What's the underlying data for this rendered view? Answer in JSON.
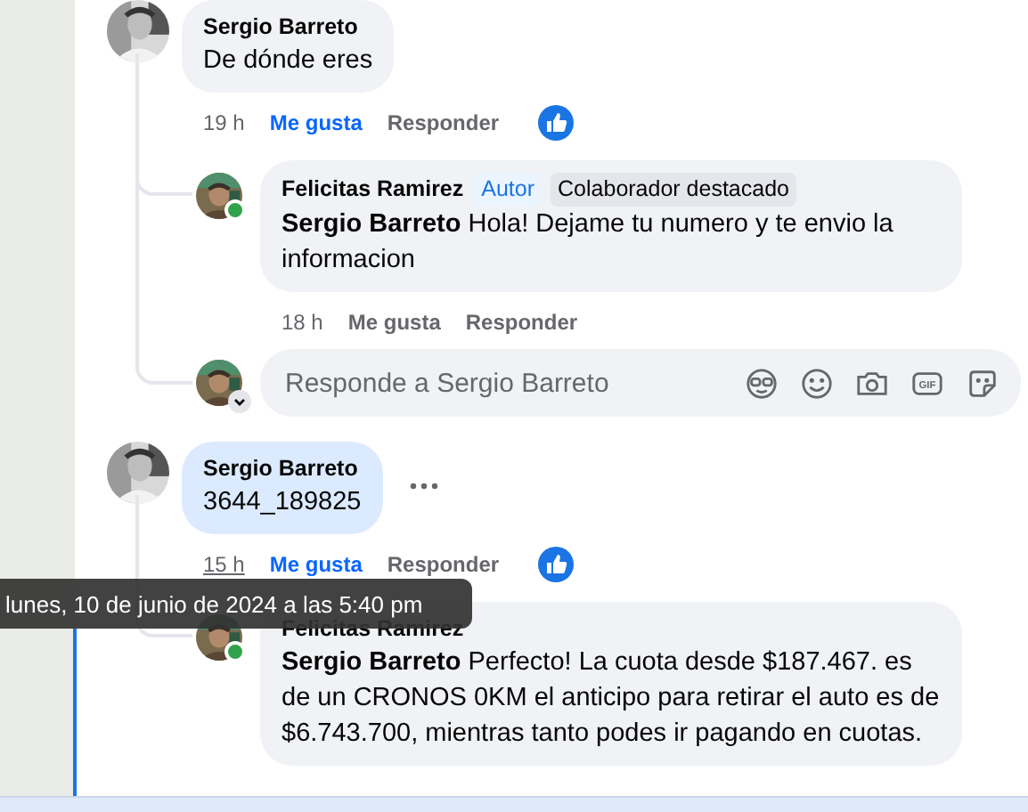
{
  "comments": [
    {
      "author": "Sergio Barreto",
      "text": "De dónde eres",
      "highlighted": false,
      "more": false,
      "time": "19 h",
      "time_hovered": false,
      "like": "Me gusta",
      "liked": true,
      "reply": "Responder",
      "reacted": true,
      "replies": [
        {
          "author": "Felicitas Ramirez",
          "online": true,
          "badges": [
            {
              "kind": "author",
              "label": "Autor"
            },
            {
              "kind": "fan",
              "label": "Colaborador destacado"
            }
          ],
          "mention": "Sergio Barreto",
          "text": "Hola! Dejame tu numero y te envio la informacion",
          "time": "18 h",
          "like": "Me gusta",
          "liked": false,
          "reply": "Responder"
        }
      ],
      "composer": {
        "placeholder": "Responde a Sergio Barreto",
        "tools": [
          {
            "kind": "avatar"
          },
          {
            "kind": "emoji"
          },
          {
            "kind": "camera"
          },
          {
            "kind": "gif",
            "label": "GIF"
          },
          {
            "kind": "sticker"
          }
        ]
      }
    },
    {
      "author": "Sergio Barreto",
      "text": "3644_189825",
      "highlighted": true,
      "more": true,
      "time": "15 h",
      "time_hovered": true,
      "like": "Me gusta",
      "liked": true,
      "reply": "Responder",
      "reacted": true,
      "replies": [
        {
          "author": "Felicitas Ramirez",
          "online": true,
          "mention": "Sergio Barreto",
          "text": "Perfecto! La cuota desde $187.467. es de un CRONOS 0KM el anticipo para retirar el auto es de $6.743.700, mientras tanto podes ir pagando en cuotas."
        }
      ]
    }
  ],
  "tooltip": "lunes, 10 de junio de 2024 a las 5:40 pm"
}
